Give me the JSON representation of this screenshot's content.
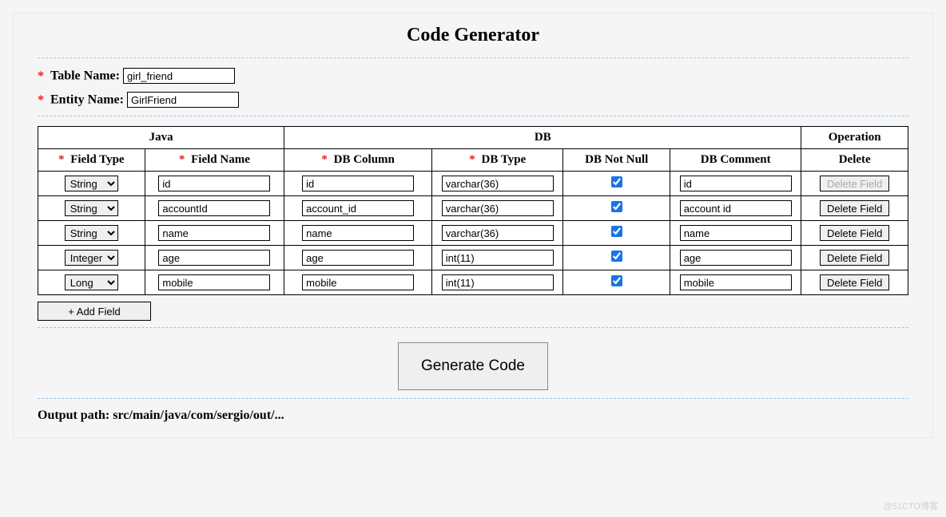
{
  "title": "Code Generator",
  "form": {
    "table_name_label": "Table Name:",
    "table_name_value": "girl_friend",
    "entity_name_label": "Entity Name:",
    "entity_name_value": "GirlFriend"
  },
  "table": {
    "group_headers": {
      "java": "Java",
      "db": "DB",
      "operation": "Operation"
    },
    "col_headers": {
      "field_type": "Field Type",
      "field_name": "Field Name",
      "db_column": "DB Column",
      "db_type": "DB Type",
      "db_not_null": "DB Not Null",
      "db_comment": "DB Comment",
      "delete": "Delete"
    },
    "field_type_options": [
      "String",
      "Integer",
      "Long"
    ],
    "rows": [
      {
        "field_type": "String",
        "field_name": "id",
        "db_column": "id",
        "db_type": "varchar(36)",
        "not_null": true,
        "comment": "id",
        "delete_disabled": true
      },
      {
        "field_type": "String",
        "field_name": "accountId",
        "db_column": "account_id",
        "db_type": "varchar(36)",
        "not_null": true,
        "comment": "account id",
        "delete_disabled": false
      },
      {
        "field_type": "String",
        "field_name": "name",
        "db_column": "name",
        "db_type": "varchar(36)",
        "not_null": true,
        "comment": "name",
        "delete_disabled": false
      },
      {
        "field_type": "Integer",
        "field_name": "age",
        "db_column": "age",
        "db_type": "int(11)",
        "not_null": true,
        "comment": "age",
        "delete_disabled": false
      },
      {
        "field_type": "Long",
        "field_name": "mobile",
        "db_column": "mobile",
        "db_type": "int(11)",
        "not_null": true,
        "comment": "mobile",
        "delete_disabled": false
      }
    ],
    "delete_button_label": "Delete Field"
  },
  "add_field_label": "+ Add Field",
  "generate_label": "Generate Code",
  "output_path_label": "Output path:",
  "output_path_value": "src/main/java/com/sergio/out/...",
  "watermark": "@51CTO博客"
}
